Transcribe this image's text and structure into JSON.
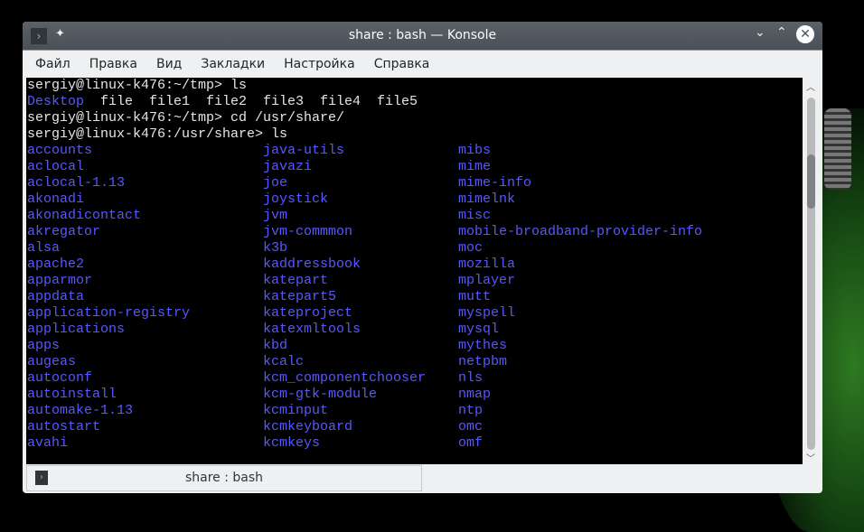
{
  "window": {
    "title": "share : bash — Konsole"
  },
  "menu": [
    "Файл",
    "Правка",
    "Вид",
    "Закладки",
    "Настройка",
    "Справка"
  ],
  "terminal": {
    "lines": [
      "sergiy@linux-k476:~/tmp> ls",
      "sergiy@linux-k476:~/tmp> cd /usr/share/",
      "sergiy@linux-k476:/usr/share> ls"
    ],
    "tmp_listing": {
      "dir": "Desktop",
      "files": "file  file1  file2  file3  file4  file5"
    },
    "columns": [
      [
        "accounts",
        "aclocal",
        "aclocal-1.13",
        "akonadi",
        "akonadicontact",
        "akregator",
        "alsa",
        "apache2",
        "apparmor",
        "appdata",
        "application-registry",
        "applications",
        "apps",
        "augeas",
        "autoconf",
        "autoinstall",
        "automake-1.13",
        "autostart",
        "avahi"
      ],
      [
        "java-utils",
        "javazi",
        "joe",
        "joystick",
        "jvm",
        "jvm-commmon",
        "k3b",
        "kaddressbook",
        "katepart",
        "katepart5",
        "kateproject",
        "katexmltools",
        "kbd",
        "kcalc",
        "kcm_componentchooser",
        "kcm-gtk-module",
        "kcminput",
        "kcmkeyboard",
        "kcmkeys"
      ],
      [
        "mibs",
        "mime",
        "mime-info",
        "mimelnk",
        "misc",
        "mobile-broadband-provider-info",
        "moc",
        "mozilla",
        "mplayer",
        "mutt",
        "myspell",
        "mysql",
        "mythes",
        "netpbm",
        "nls",
        "nmap",
        "ntp",
        "omc",
        "omf"
      ]
    ]
  },
  "tab": {
    "label": "share : bash"
  },
  "colors": {
    "dir": "#5858ff",
    "accent": "#3daee9"
  }
}
